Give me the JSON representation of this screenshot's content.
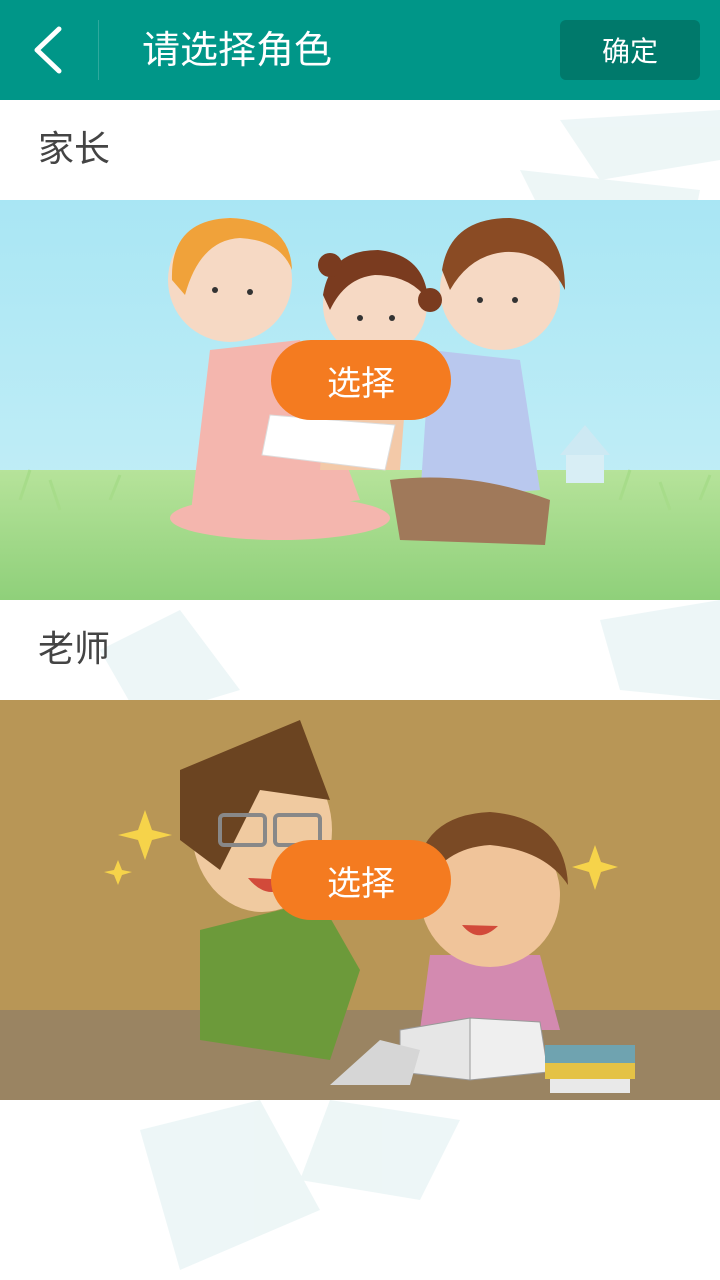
{
  "header": {
    "title": "请选择角色",
    "confirm_label": "确定",
    "back_icon": "chevron-left-icon"
  },
  "roles": [
    {
      "label": "家长",
      "select_label": "选择",
      "illustration": "family-illustration"
    },
    {
      "label": "老师",
      "select_label": "选择",
      "illustration": "teacher-student-illustration"
    }
  ],
  "colors": {
    "header_bg": "#009688",
    "confirm_bg": "#00796b",
    "select_bg": "#f47b20"
  }
}
